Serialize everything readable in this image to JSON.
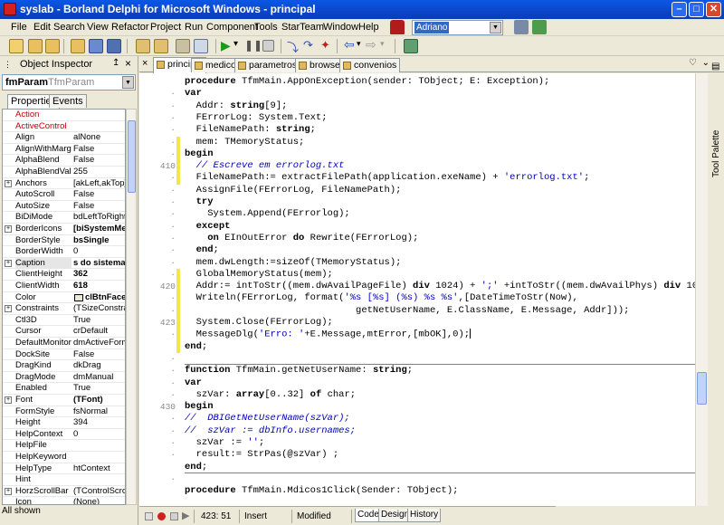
{
  "window": {
    "title": "syslab - Borland Delphi for Microsoft Windows - principal"
  },
  "menu": [
    "File",
    "Edit",
    "Search",
    "View",
    "Refactor",
    "Project",
    "Run",
    "Component",
    "Tools",
    "StarTeam",
    "Window",
    "Help"
  ],
  "desktop_combo": "Adriano",
  "object_inspector": {
    "title": "Object Inspector",
    "object_name": "fmParam",
    "object_type": "TfmParam",
    "tabs": [
      "Properties",
      "Events"
    ],
    "properties": [
      {
        "name": "Action",
        "value": "",
        "red": true
      },
      {
        "name": "ActiveControl",
        "value": "",
        "red": true
      },
      {
        "name": "Align",
        "value": "alNone"
      },
      {
        "name": "AlignWithMargins",
        "value": "False"
      },
      {
        "name": "AlphaBlend",
        "value": "False"
      },
      {
        "name": "AlphaBlendValue",
        "value": "255"
      },
      {
        "name": "Anchors",
        "value": "[akLeft,akTop]",
        "expand": true
      },
      {
        "name": "AutoScroll",
        "value": "False"
      },
      {
        "name": "AutoSize",
        "value": "False"
      },
      {
        "name": "BiDiMode",
        "value": "bdLeftToRight"
      },
      {
        "name": "BorderIcons",
        "value": "[biSystemMe",
        "expand": true,
        "bold": true
      },
      {
        "name": "BorderStyle",
        "value": "bsSingle",
        "bold": true
      },
      {
        "name": "BorderWidth",
        "value": "0"
      },
      {
        "name": "Caption",
        "value": "s do sistema",
        "expand": true,
        "bold": true,
        "selected": true
      },
      {
        "name": "ClientHeight",
        "value": "362",
        "bold": true
      },
      {
        "name": "ClientWidth",
        "value": "618",
        "bold": true
      },
      {
        "name": "Color",
        "value": "clBtnFace",
        "bold": true,
        "swatch": true
      },
      {
        "name": "Constraints",
        "value": "(TSizeConstrai",
        "expand": true
      },
      {
        "name": "Ctl3D",
        "value": "True"
      },
      {
        "name": "Cursor",
        "value": "crDefault"
      },
      {
        "name": "DefaultMonitor",
        "value": "dmActiveForm"
      },
      {
        "name": "DockSite",
        "value": "False"
      },
      {
        "name": "DragKind",
        "value": "dkDrag"
      },
      {
        "name": "DragMode",
        "value": "dmManual"
      },
      {
        "name": "Enabled",
        "value": "True"
      },
      {
        "name": "Font",
        "value": "(TFont)",
        "expand": true,
        "bold": true
      },
      {
        "name": "FormStyle",
        "value": "fsNormal"
      },
      {
        "name": "Height",
        "value": "394"
      },
      {
        "name": "HelpContext",
        "value": "0"
      },
      {
        "name": "HelpFile",
        "value": ""
      },
      {
        "name": "HelpKeyword",
        "value": ""
      },
      {
        "name": "HelpType",
        "value": "htContext"
      },
      {
        "name": "Hint",
        "value": ""
      },
      {
        "name": "HorzScrollBar",
        "value": "(TControlScrollB",
        "expand": true
      },
      {
        "name": "Icon",
        "value": "(None)"
      }
    ],
    "status": "All shown"
  },
  "editor": {
    "tabs": [
      "principal",
      "medicos",
      "parametros",
      "browse",
      "convenios"
    ],
    "active_tab": "principal",
    "gutter": [
      {
        "line": 0,
        "text": ""
      },
      {
        "line": 1,
        "text": "·"
      },
      {
        "line": 2,
        "text": "·"
      },
      {
        "line": 3,
        "text": "·"
      },
      {
        "line": 4,
        "text": "·"
      },
      {
        "line": 5,
        "text": "·"
      },
      {
        "line": 6,
        "text": "·"
      },
      {
        "line": 7,
        "text": "410"
      },
      {
        "line": 8,
        "text": "·"
      },
      {
        "line": 9,
        "text": "·"
      },
      {
        "line": 10,
        "text": "·"
      },
      {
        "line": 11,
        "text": "·"
      },
      {
        "line": 12,
        "text": "·"
      },
      {
        "line": 13,
        "text": "·"
      },
      {
        "line": 14,
        "text": "·"
      },
      {
        "line": 15,
        "text": "·"
      },
      {
        "line": 16,
        "text": "·"
      },
      {
        "line": 17,
        "text": "420"
      },
      {
        "line": 18,
        "text": "·"
      },
      {
        "line": 19,
        "text": "·"
      },
      {
        "line": 20,
        "text": "423"
      },
      {
        "line": 21,
        "text": "·"
      },
      {
        "line": 22,
        "text": ""
      },
      {
        "line": 23,
        "text": "·"
      },
      {
        "line": 24,
        "text": "·"
      },
      {
        "line": 25,
        "text": "·"
      },
      {
        "line": 26,
        "text": "·"
      },
      {
        "line": 27,
        "text": "430"
      },
      {
        "line": 28,
        "text": "·"
      },
      {
        "line": 29,
        "text": "·"
      },
      {
        "line": 30,
        "text": "·"
      },
      {
        "line": 31,
        "text": "·"
      },
      {
        "line": 32,
        "text": ""
      },
      {
        "line": 33,
        "text": "·"
      }
    ],
    "lines": [
      [
        {
          "t": "procedure",
          "c": "kw"
        },
        {
          "t": " TfmMain.AppOnException(sender: TObject; E: Exception);"
        }
      ],
      [
        {
          "t": "var",
          "c": "kw"
        }
      ],
      [
        {
          "t": "  Addr: "
        },
        {
          "t": "string",
          "c": "kw"
        },
        {
          "t": "[9];"
        }
      ],
      [
        {
          "t": "  FErrorLog: System.Text;"
        }
      ],
      [
        {
          "t": "  FileNamePath: "
        },
        {
          "t": "string",
          "c": "kw"
        },
        {
          "t": ";"
        }
      ],
      [
        {
          "t": "  mem: TMemoryStatus;"
        }
      ],
      [
        {
          "t": "begin",
          "c": "kw"
        }
      ],
      [
        {
          "t": "  "
        },
        {
          "t": "// Escreve em errorlog.txt",
          "c": "cm"
        }
      ],
      [
        {
          "t": "  FileNamePath:= extractFilePath(application.exeName) + "
        },
        {
          "t": "'errorlog.txt'",
          "c": "st"
        },
        {
          "t": ";"
        }
      ],
      [
        {
          "t": "  AssignFile(FErrorLog, FileNamePath);"
        }
      ],
      [
        {
          "t": "  "
        },
        {
          "t": "try",
          "c": "kw"
        }
      ],
      [
        {
          "t": "    System.Append(FErrorlog);"
        }
      ],
      [
        {
          "t": "  "
        },
        {
          "t": "except",
          "c": "kw"
        }
      ],
      [
        {
          "t": "    "
        },
        {
          "t": "on",
          "c": "kw"
        },
        {
          "t": " EInOutError "
        },
        {
          "t": "do",
          "c": "kw"
        },
        {
          "t": " Rewrite(FErrorLog);"
        }
      ],
      [
        {
          "t": "  "
        },
        {
          "t": "end",
          "c": "kw"
        },
        {
          "t": ";"
        }
      ],
      [
        {
          "t": "  mem.dwLength:=sizeOf(TMemoryStatus);"
        }
      ],
      [
        {
          "t": "  GlobalMemoryStatus(mem);"
        }
      ],
      [
        {
          "t": "  Addr:= intToStr((mem.dwAvailPageFile) "
        },
        {
          "t": "div",
          "c": "kw"
        },
        {
          "t": " 1024) + "
        },
        {
          "t": "';'",
          "c": "st"
        },
        {
          "t": " +intToStr((mem.dwAvailPhys) "
        },
        {
          "t": "div",
          "c": "kw"
        },
        {
          "t": " 10"
        }
      ],
      [
        {
          "t": "  Writeln(FErrorLog, format("
        },
        {
          "t": "'%s [%s] (%s) %s %s'",
          "c": "st"
        },
        {
          "t": ",[DateTimeToStr(Now),"
        }
      ],
      [
        {
          "t": "                              getNetUserName, E.ClassName, E.Message, Addr]));"
        }
      ],
      [
        {
          "t": "  System.Close(FErrorLog);"
        }
      ],
      [
        {
          "t": "  MessageDlg("
        },
        {
          "t": "'Erro: '",
          "c": "st"
        },
        {
          "t": "+E.Message,mtError,[mbOK],0);"
        },
        {
          "t": "",
          "c": "cursor"
        }
      ],
      [
        {
          "t": "end",
          "c": "kw"
        },
        {
          "t": ";"
        }
      ],
      [
        {
          "t": ""
        }
      ],
      [
        {
          "t": "function",
          "c": "kw"
        },
        {
          "t": " TfmMain.getNetUserName: "
        },
        {
          "t": "string",
          "c": "kw"
        },
        {
          "t": ";"
        }
      ],
      [
        {
          "t": "var",
          "c": "kw"
        }
      ],
      [
        {
          "t": "  szVar: "
        },
        {
          "t": "array",
          "c": "kw"
        },
        {
          "t": "[0..32] "
        },
        {
          "t": "of",
          "c": "kw"
        },
        {
          "t": " char;"
        }
      ],
      [
        {
          "t": "begin",
          "c": "kw"
        }
      ],
      [
        {
          "t": "//  DBIGetNetUserName(szVar);",
          "c": "cm"
        }
      ],
      [
        {
          "t": "//  szVar := dbInfo.usernames;",
          "c": "cm"
        }
      ],
      [
        {
          "t": "  szVar := "
        },
        {
          "t": "''",
          "c": "st"
        },
        {
          "t": ";"
        }
      ],
      [
        {
          "t": "  result:= StrPas(@szVar) ;"
        }
      ],
      [
        {
          "t": "end",
          "c": "kw"
        },
        {
          "t": ";"
        }
      ],
      [
        {
          "t": ""
        }
      ],
      [
        {
          "t": "procedure",
          "c": "kw"
        },
        {
          "t": " TfmMain.Mdicos1Click(Sender: TObject);"
        }
      ]
    ],
    "modified_lines": [
      7,
      17,
      20
    ],
    "tool_palette": "Tool Palette"
  },
  "status": {
    "position": "423: 51",
    "mode": "Insert",
    "modified": "Modified",
    "tabs": [
      "Code",
      "Design",
      "History"
    ],
    "active_tab": "Code"
  }
}
